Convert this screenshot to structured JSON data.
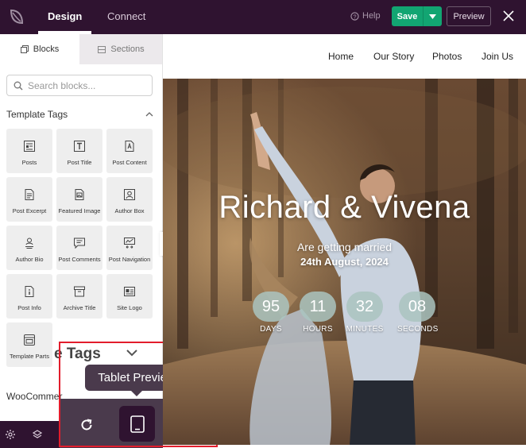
{
  "topbar": {
    "tabs": [
      {
        "label": "Design"
      },
      {
        "label": "Connect"
      }
    ],
    "help_label": "Help",
    "save_label": "Save",
    "preview_label": "Preview"
  },
  "sidebar": {
    "tabs": [
      {
        "label": "Blocks"
      },
      {
        "label": "Sections"
      }
    ],
    "search_placeholder": "Search blocks...",
    "section_title": "Template Tags",
    "blocks": [
      {
        "label": "Posts",
        "icon": "posts-icon"
      },
      {
        "label": "Post Title",
        "icon": "post-title-icon"
      },
      {
        "label": "Post Content",
        "icon": "post-content-icon"
      },
      {
        "label": "Post Excerpt",
        "icon": "post-excerpt-icon"
      },
      {
        "label": "Featured Image",
        "icon": "featured-image-icon"
      },
      {
        "label": "Author Box",
        "icon": "author-box-icon"
      },
      {
        "label": "Author Bio",
        "icon": "author-bio-icon"
      },
      {
        "label": "Post Comments",
        "icon": "post-comments-icon"
      },
      {
        "label": "Post Navigation",
        "icon": "post-navigation-icon"
      },
      {
        "label": "Post Info",
        "icon": "post-info-icon"
      },
      {
        "label": "Archive Title",
        "icon": "archive-title-icon"
      },
      {
        "label": "Site Logo",
        "icon": "site-logo-icon"
      },
      {
        "label": "Template Parts",
        "icon": "template-parts-icon"
      }
    ],
    "ghost_heading": "e Tags",
    "woo_label": "WooCommer"
  },
  "device_preview": {
    "tooltip": "Tablet Preview"
  },
  "site": {
    "nav": [
      {
        "label": "Home"
      },
      {
        "label": "Our Story"
      },
      {
        "label": "Photos"
      },
      {
        "label": "Join Us"
      }
    ],
    "title": "Richard & Vivena",
    "subtitle": "Are getting married",
    "date": "24th August, 2024",
    "countdown": [
      {
        "value": "95",
        "unit": "DAYS"
      },
      {
        "value": "11",
        "unit": "HOURS"
      },
      {
        "value": "32",
        "unit": "MINUTES"
      },
      {
        "value": "08",
        "unit": "SECONDS"
      }
    ]
  },
  "colors": {
    "topbar": "#2f1330",
    "save": "#12a572",
    "device_bar": "#4a3a4c",
    "highlight": "#e21d2c"
  }
}
